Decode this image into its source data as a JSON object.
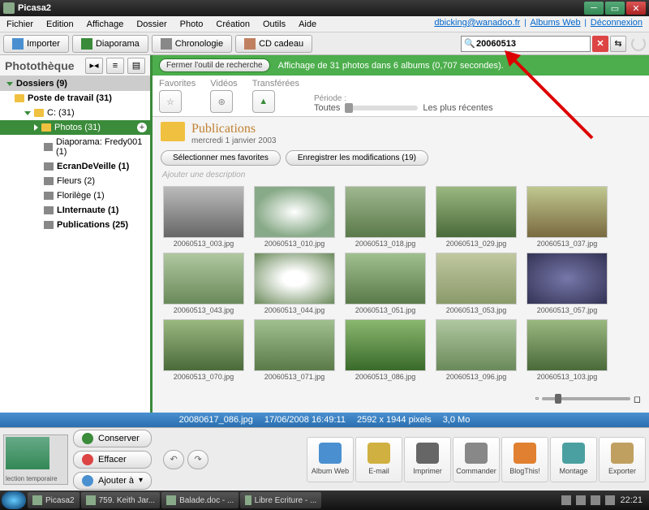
{
  "window": {
    "title": "Picasa2"
  },
  "menubar": [
    "Fichier",
    "Edition",
    "Affichage",
    "Dossier",
    "Photo",
    "Création",
    "Outils",
    "Aide"
  ],
  "user": {
    "email": "dbicking@wanadoo.fr",
    "web": "Albums Web",
    "logout": "Déconnexion"
  },
  "toolbar": {
    "import": "Importer",
    "diaporama": "Diaporama",
    "chronologie": "Chronologie",
    "cd": "CD cadeau"
  },
  "search": {
    "value": "20060513"
  },
  "sidebar": {
    "library": "Photothèque",
    "dossiers": "Dossiers (9)",
    "poste": "Poste de travail (31)",
    "c": "C: (31)",
    "photos": "Photos (31)",
    "items": [
      "Diaporama: Fredy001 (1)",
      "EcranDeVeille (1)",
      "Fleurs (2)",
      "Florilège (1)",
      "LInternaute (1)",
      "Publications (25)"
    ]
  },
  "greenbar": {
    "close": "Fermer l'outil de recherche",
    "msg": "Affichage de 31 photos dans 6 albums (0,707 secondes)."
  },
  "filters": {
    "fav": "Favorites",
    "vid": "Vidéos",
    "trans": "Transférées",
    "period": "Période :",
    "all": "Toutes",
    "recent": "Les plus récentes"
  },
  "album": {
    "title": "Publications",
    "date": "mercredi 1 janvier 2003",
    "selfav": "Sélectionner mes favorites",
    "savemod": "Enregistrer les modifications (19)",
    "desc": "Ajouter une description"
  },
  "thumbs": [
    "20060513_003.jpg",
    "20060513_010.jpg",
    "20060513_018.jpg",
    "20060513_029.jpg",
    "20060513_037.jpg",
    "20060513_043.jpg",
    "20060513_044.jpg",
    "20060513_051.jpg",
    "20060513_053.jpg",
    "20060513_057.jpg",
    "20060513_070.jpg",
    "20060513_071.jpg",
    "20060513_086.jpg",
    "20060513_096.jpg",
    "20060513_103.jpg"
  ],
  "thumb_colors": [
    "linear-gradient(#bbb,#666)",
    "radial-gradient(#fff,#8a8 70%)",
    "linear-gradient(#a0b890,#5a7a4a)",
    "linear-gradient(#9ab880,#4a6a3a)",
    "linear-gradient(#c0c890,#7a6a40)",
    "linear-gradient(#b0c8a0,#6a8a5a)",
    "radial-gradient(#fff 20%,#6a8a5a)",
    "linear-gradient(#a0c090,#5a7a4a)",
    "linear-gradient(#c0c8a0,#8a9a6a)",
    "radial-gradient(#77a,#335)",
    "linear-gradient(#9ab880,#4a6a3a)",
    "linear-gradient(#a0c090,#5a7a4a)",
    "linear-gradient(#8ab870,#3a6a2a)",
    "linear-gradient(#b0c8a0,#6a8a5a)",
    "linear-gradient(#9ab880,#4a6a3a)"
  ],
  "infobar": {
    "file": "20080617_086.jpg",
    "date": "17/06/2008 16:49:11",
    "dims": "2592 x 1944 pixels",
    "size": "3,0 Mo"
  },
  "tray": {
    "label": "lection temporaire"
  },
  "bottom": {
    "keep": "Conserver",
    "clear": "Effacer",
    "add": "Ajouter à"
  },
  "actions": [
    "Album Web",
    "E-mail",
    "Imprimer",
    "Commander",
    "BlogThis!",
    "Montage",
    "Exporter"
  ],
  "action_colors": [
    "#4a90d0",
    "#d0b040",
    "#666",
    "#888",
    "#e08030",
    "#4aa0a0",
    "#c0a060"
  ],
  "taskbar": {
    "items": [
      "Picasa2",
      "759. Keith Jar...",
      "Balade.doc - ...",
      "Libre Ecriture - ..."
    ],
    "clock": "22:21"
  }
}
